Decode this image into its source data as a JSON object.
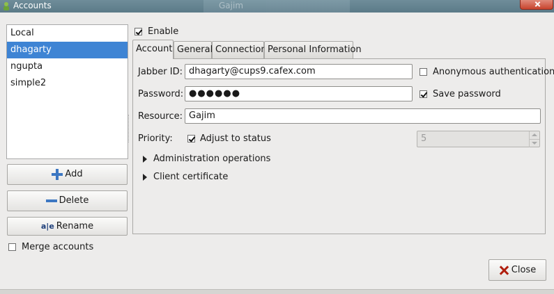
{
  "window": {
    "title": "Accounts",
    "background_window_title": "Gajim"
  },
  "accounts": {
    "items": [
      "Local",
      "dhagarty",
      "ngupta",
      "simple2"
    ],
    "selected_index": 1
  },
  "buttons": {
    "add": "Add",
    "delete": "Delete",
    "rename": "Rename",
    "close": "Close"
  },
  "merge": {
    "label": "Merge accounts",
    "checked": false
  },
  "enable": {
    "label": "Enable",
    "checked": true
  },
  "tabs": [
    "Account",
    "General",
    "Connection",
    "Personal Information"
  ],
  "active_tab": "Account",
  "account_tab": {
    "jabber_id_label": "Jabber ID:",
    "jabber_id": "dhagarty@cups9.cafex.com",
    "anonymous_label": "Anonymous authentication",
    "anonymous_checked": false,
    "password_label": "Password:",
    "password_masked": "●●●●●●",
    "save_password_label": "Save password",
    "save_password_checked": true,
    "resource_label": "Resource:",
    "resource": "Gajim",
    "priority_label": "Priority:",
    "adjust_label": "Adjust to status",
    "adjust_checked": true,
    "priority_value": "5",
    "admin_expander": "Administration operations",
    "cert_expander": "Client certificate"
  },
  "colors": {
    "selection": "#3e84d4",
    "titlebar": "#5b7a88",
    "accent_icon": "#3c77c2",
    "close_icon": "#b01e0e"
  }
}
